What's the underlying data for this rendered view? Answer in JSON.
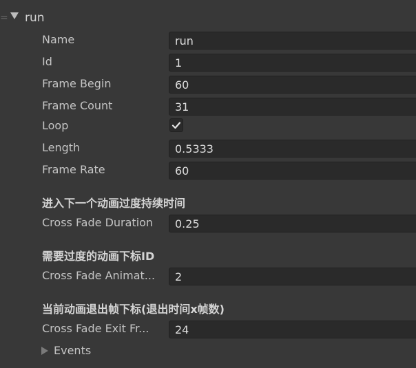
{
  "handle_glyph": "=",
  "foldout": {
    "title": "run",
    "expanded": true
  },
  "fields": {
    "name": {
      "label": "Name",
      "value": "run"
    },
    "id": {
      "label": "Id",
      "value": "1"
    },
    "frame_begin": {
      "label": "Frame Begin",
      "value": "60"
    },
    "frame_count": {
      "label": "Frame Count",
      "value": "31"
    },
    "loop": {
      "label": "Loop",
      "checked": true
    },
    "length": {
      "label": "Length",
      "value": "0.5333"
    },
    "frame_rate": {
      "label": "Frame Rate",
      "value": "60"
    }
  },
  "sections": {
    "cross_fade_duration": {
      "header": "进入下一个动画过度持续时间",
      "label": "Cross Fade Duration",
      "value": "0.25"
    },
    "cross_fade_animation": {
      "header": "需要过度的动画下标ID",
      "label": "Cross Fade Animat...",
      "value": "2"
    },
    "cross_fade_exit_frame": {
      "header": "当前动画退出帧下标(退出时间x帧数)",
      "label": "Cross Fade Exit Fr...",
      "value": "24"
    }
  },
  "events": {
    "label": "Events",
    "expanded": false
  },
  "icons": {
    "foldout": "triangle-down-icon",
    "events": "triangle-right-icon",
    "check": "checkmark-icon",
    "handle": "drag-handle-icon"
  },
  "colors": {
    "background": "#383838",
    "field_background": "#2a2a2a",
    "text": "#c4c4c4"
  }
}
